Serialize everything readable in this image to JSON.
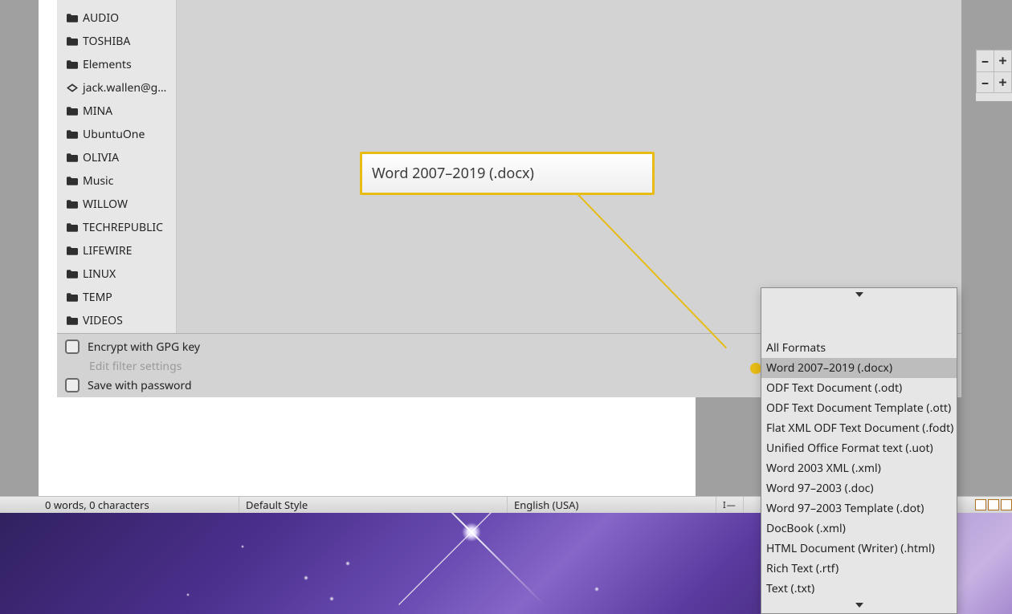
{
  "sidebar": {
    "items": [
      {
        "label": "AUDIO",
        "icon": "folder-icon"
      },
      {
        "label": "TOSHIBA",
        "icon": "folder-icon"
      },
      {
        "label": "Elements",
        "icon": "folder-icon"
      },
      {
        "label": "jack.wallen@g…",
        "icon": "drive-icon"
      },
      {
        "label": "MINA",
        "icon": "folder-icon"
      },
      {
        "label": "UbuntuOne",
        "icon": "folder-icon"
      },
      {
        "label": "OLIVIA",
        "icon": "folder-icon"
      },
      {
        "label": "Music",
        "icon": "folder-icon"
      },
      {
        "label": "WILLOW",
        "icon": "folder-icon"
      },
      {
        "label": "TECHREPUBLIC",
        "icon": "folder-icon"
      },
      {
        "label": "LIFEWIRE",
        "icon": "folder-icon"
      },
      {
        "label": "LINUX",
        "icon": "folder-icon"
      },
      {
        "label": "TEMP",
        "icon": "folder-icon"
      },
      {
        "label": "VIDEOS",
        "icon": "folder-icon"
      }
    ]
  },
  "dialog_options": {
    "encrypt": "Encrypt with GPG key",
    "edit_filter": "Edit filter settings",
    "save_pw": "Save with password"
  },
  "callout": {
    "text": "Word 2007–2019 (.docx)"
  },
  "format_dropdown": {
    "items": [
      "All Formats",
      "Word 2007–2019 (.docx)",
      "ODF Text Document (.odt)",
      "ODF Text Document Template (.ott)",
      "Flat XML ODF Text Document (.fodt)",
      "Unified Office Format text (.uot)",
      "Word 2003 XML (.xml)",
      "Word 97–2003 (.doc)",
      "Word 97–2003 Template (.dot)",
      "DocBook (.xml)",
      "HTML Document (Writer) (.html)",
      "Rich Text (.rtf)",
      "Text (.txt)"
    ],
    "selected_index": 1
  },
  "status_bar": {
    "wordcount": "0 words, 0 characters",
    "style": "Default Style",
    "language": "English (USA)",
    "insert_mode": "I—"
  },
  "zoom": {
    "minus": "–",
    "plus": "+"
  }
}
